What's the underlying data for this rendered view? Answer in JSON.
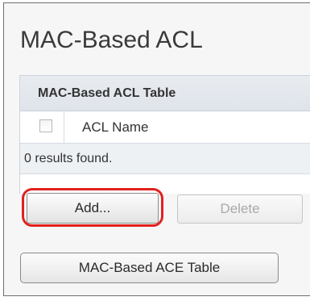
{
  "page": {
    "title": "MAC-Based ACL"
  },
  "table": {
    "caption": "MAC-Based ACL Table",
    "columns": [
      "ACL Name"
    ],
    "rows": [],
    "results_text": "0 results found."
  },
  "buttons": {
    "add": "Add...",
    "delete": "Delete",
    "ace_table": "MAC-Based ACE Table"
  },
  "colors": {
    "highlight": "#e0211f",
    "table_header_bg": "#e3e8ee",
    "results_row_bg": "#eef1f4"
  }
}
